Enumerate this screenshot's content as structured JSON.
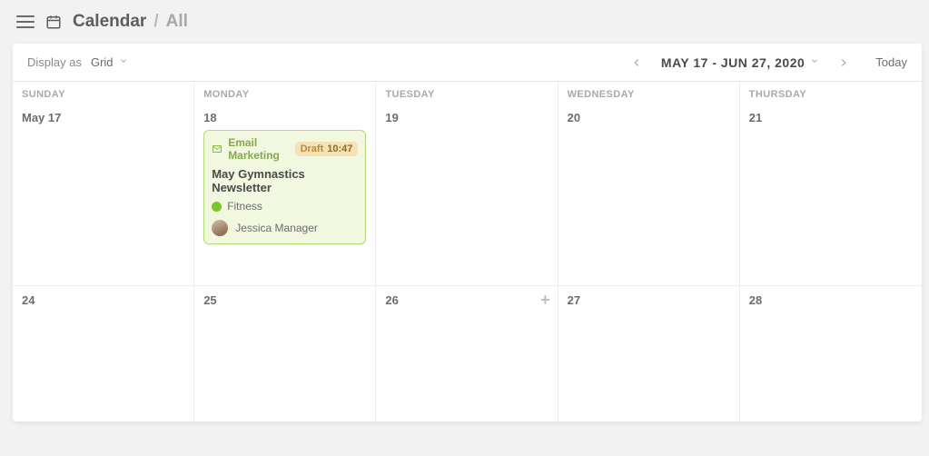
{
  "breadcrumb": {
    "title": "Calendar",
    "sub": "All"
  },
  "toolbar": {
    "display_label": "Display as",
    "display_value": "Grid",
    "range_text": "MAY 17 - JUN 27, 2020",
    "today_label": "Today"
  },
  "week1": {
    "headers": [
      "SUNDAY",
      "MONDAY",
      "TUESDAY",
      "WEDNESDAY",
      "THURSDAY"
    ],
    "days": [
      "May 17",
      "18",
      "19",
      "20",
      "21"
    ]
  },
  "week2": {
    "days": [
      "24",
      "25",
      "26",
      "27",
      "28"
    ]
  },
  "event": {
    "type_label": "Email Marketing",
    "status": "Draft",
    "time": "10:47",
    "title": "May Gymnastics Newsletter",
    "tag": "Fitness",
    "tag_color": "#7ac52a",
    "assignee": "Jessica Manager"
  }
}
